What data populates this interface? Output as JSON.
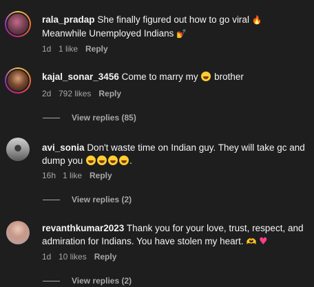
{
  "comments": [
    {
      "username": "rala_pradap",
      "text_line1": "She finally figured out how to go viral",
      "text_line2": "Meanwhile Unemployed Indians",
      "emoji1": "fire-icon",
      "emoji2": "woman-nail-polish-icon",
      "time": "1d",
      "likes": "1 like",
      "reply": "Reply"
    },
    {
      "username": "kajal_sonar_3456",
      "text_before": "Come to marry my",
      "emoji": "heart-eyes-icon",
      "text_after": "brother",
      "time": "2d",
      "likes": "792 likes",
      "reply": "Reply",
      "view_replies": "View replies (85)"
    },
    {
      "username": "avi_sonia",
      "text_line1": "Don't waste time on Indian guy. They will take gc and",
      "text_line2": "dump you",
      "emoji": "grinning-face-icon",
      "time": "16h",
      "likes": "1 like",
      "reply": "Reply",
      "view_replies": "View replies (2)"
    },
    {
      "username": "revanthkumar2023",
      "text_line1": "Thank you for your love, trust, respect, and",
      "text_line2": "admiration for Indians. You have stolen my heart.",
      "emoji1": "heart-hands-icon",
      "emoji2": "pink-heart-icon",
      "time": "1d",
      "likes": "10 likes",
      "reply": "Reply",
      "view_replies": "View replies (2)"
    }
  ],
  "colors": {
    "background": "#1e1e1e",
    "text": "#f5f5f5",
    "muted": "#a8a8a8"
  }
}
